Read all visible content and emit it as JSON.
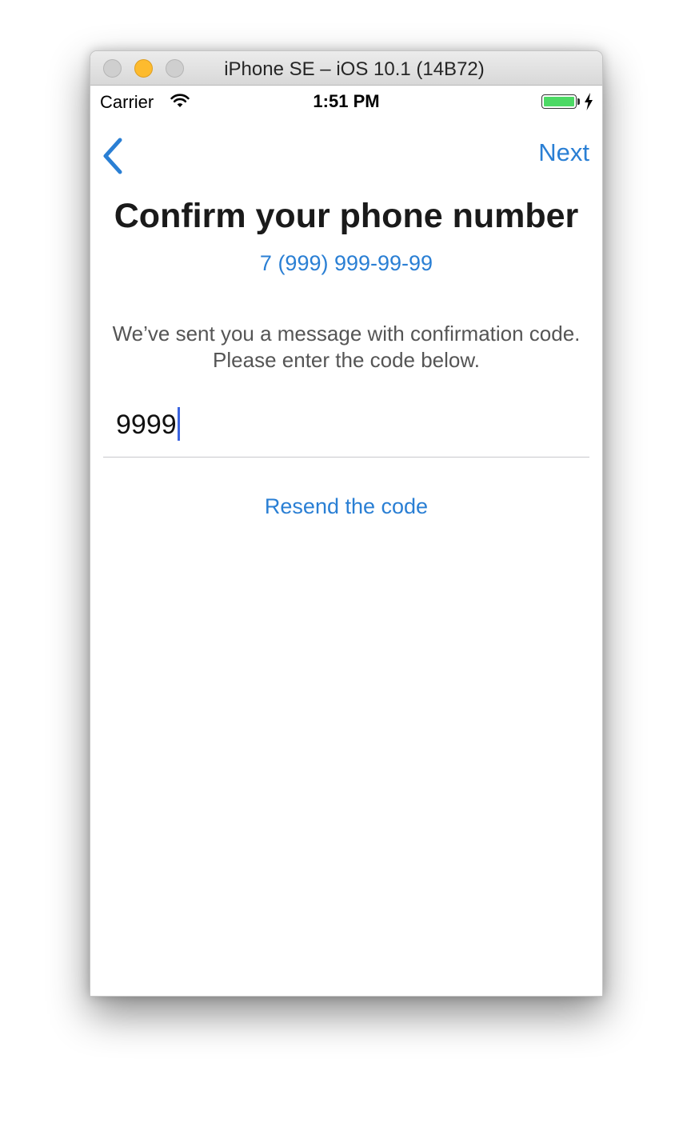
{
  "window": {
    "title": "iPhone SE – iOS 10.1 (14B72)"
  },
  "status_bar": {
    "carrier": "Carrier",
    "time": "1:51 PM",
    "battery_level": 1.0,
    "charging": true
  },
  "nav": {
    "back_icon": "chevron-left-icon",
    "next_label": "Next"
  },
  "main": {
    "title": "Confirm your phone number",
    "phone": "7 (999) 999-99-99",
    "instructions": [
      "We’ve sent you a message with confirmation code.",
      "Please enter the code below."
    ],
    "code_value": "9999",
    "resend_label": "Resend the code"
  },
  "colors": {
    "accent": "#2a7fd4",
    "caret": "#3b64e0",
    "battery": "#4cd964"
  }
}
